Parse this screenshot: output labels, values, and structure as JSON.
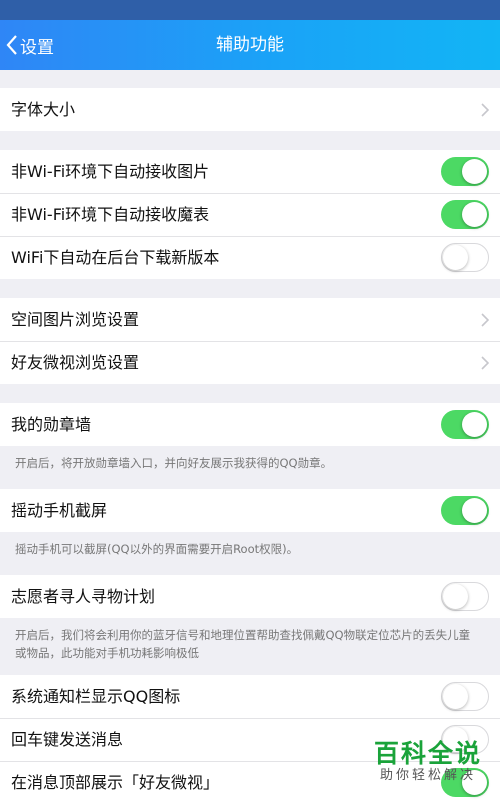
{
  "nav": {
    "back_label": "设置",
    "title": "辅助功能"
  },
  "sections": {
    "font": {
      "font_size": "字体大小"
    },
    "network": {
      "auto_receive_images": "非Wi-Fi环境下自动接收图片",
      "auto_receive_magic": "非Wi-Fi环境下自动接收魔表",
      "auto_download_update": "WiFi下自动在后台下载新版本"
    },
    "browse": {
      "qzone_images": "空间图片浏览设置",
      "friend_weishi": "好友微视浏览设置"
    },
    "medal": {
      "label": "我的勋章墙",
      "hint": "开启后，将开放勋章墙入口，并向好友展示我获得的QQ勋章。"
    },
    "shake": {
      "label": "摇动手机截屏",
      "hint": "摇动手机可以截屏(QQ以外的界面需要开启Root权限)。"
    },
    "volunteer": {
      "label": "志愿者寻人寻物计划",
      "hint": "开启后，我们将会利用你的蓝牙信号和地理位置帮助查找佩戴QQ物联定位芯片的丢失儿童或物品，此功能对手机功耗影响极低"
    },
    "misc": {
      "notif_icon": "系统通知栏显示QQ图标",
      "enter_send": "回车键发送消息",
      "top_weishi": "在消息顶部展示「好友微视」"
    }
  },
  "toggles": {
    "auto_receive_images": true,
    "auto_receive_magic": true,
    "auto_download_update": false,
    "medal": true,
    "shake": true,
    "volunteer": false,
    "notif_icon": false,
    "enter_send": false,
    "top_weishi": true
  },
  "watermark": {
    "title": "百科全说",
    "subtitle": "助你轻松解决"
  },
  "colors": {
    "nav_start": "#2f86f6",
    "nav_end": "#12b5f5",
    "toggle_on": "#4cd964",
    "background": "#efeff4",
    "watermark": "#1aa33a"
  }
}
